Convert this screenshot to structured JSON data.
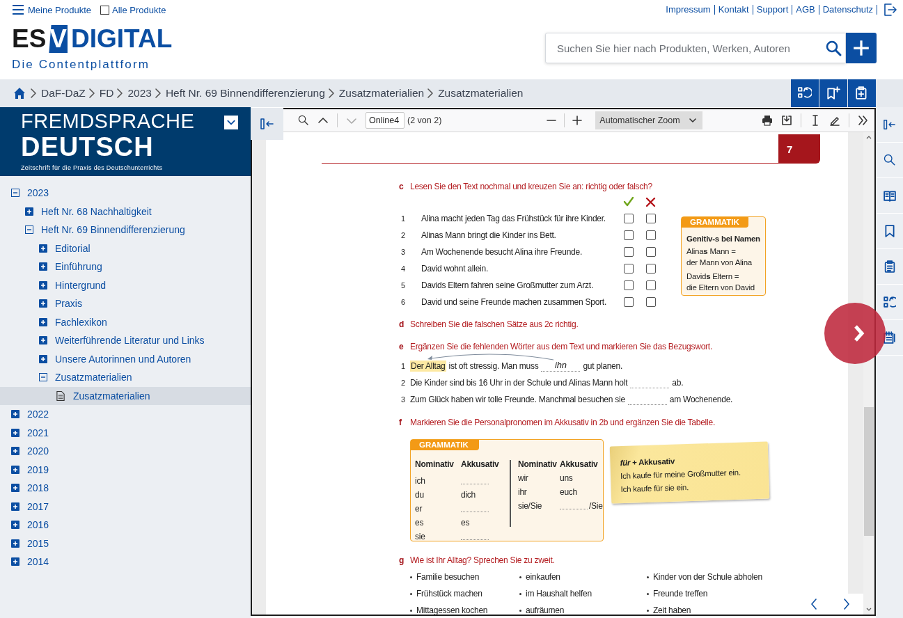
{
  "header": {
    "menu_label": "Meine Produkte",
    "all_products": {
      "label": "Alle Produkte",
      "checked": false
    },
    "links": [
      "Impressum",
      "Kontakt",
      "Support",
      "AGB",
      "Datenschutz"
    ]
  },
  "logo": {
    "prefix": "ES",
    "mark": "V",
    "name": "DIGITAL",
    "tagline": "Die Contentplattform"
  },
  "search": {
    "placeholder": "Suchen Sie hier nach Produkten, Werken, Autoren"
  },
  "breadcrumb": [
    "DaF-DaZ",
    "FD",
    "2023",
    "Heft Nr. 69 Binnendifferenzierung",
    "Zusatzmaterialien",
    "Zusatzmaterialien"
  ],
  "sidebar": {
    "banner": {
      "line1": "FREMDSPRACHE",
      "line2": "DEUTSCH",
      "subtitle": "Zeitschrift für die Praxis des Deutschunterrichts"
    },
    "tree": [
      {
        "label": "2023",
        "kind": "folder",
        "expanded": true,
        "selected": false,
        "children": [
          {
            "label": "Heft Nr. 68 Nachhaltigkeit",
            "kind": "folder",
            "expanded": false,
            "selected": false
          },
          {
            "label": "Heft Nr. 69 Binnendifferenzierung",
            "kind": "folder",
            "expanded": true,
            "selected": false,
            "children": [
              {
                "label": "Editorial",
                "kind": "folder",
                "expanded": false,
                "selected": false
              },
              {
                "label": "Einführung",
                "kind": "folder",
                "expanded": false,
                "selected": false
              },
              {
                "label": "Hintergrund",
                "kind": "folder",
                "expanded": false,
                "selected": false
              },
              {
                "label": "Praxis",
                "kind": "folder",
                "expanded": false,
                "selected": false
              },
              {
                "label": "Fachlexikon",
                "kind": "folder",
                "expanded": false,
                "selected": false
              },
              {
                "label": "Weiterführende Literatur und Links",
                "kind": "folder",
                "expanded": false,
                "selected": false
              },
              {
                "label": "Unsere Autorinnen und Autoren",
                "kind": "folder",
                "expanded": false,
                "selected": false
              },
              {
                "label": "Zusatzmaterialien",
                "kind": "folder",
                "expanded": true,
                "selected": false,
                "children": [
                  {
                    "label": "Zusatzmaterialien",
                    "kind": "document",
                    "selected": true
                  }
                ]
              }
            ]
          }
        ]
      },
      {
        "label": "2022",
        "kind": "folder",
        "expanded": false,
        "selected": false
      },
      {
        "label": "2021",
        "kind": "folder",
        "expanded": false,
        "selected": false
      },
      {
        "label": "2020",
        "kind": "folder",
        "expanded": false,
        "selected": false
      },
      {
        "label": "2019",
        "kind": "folder",
        "expanded": false,
        "selected": false
      },
      {
        "label": "2018",
        "kind": "folder",
        "expanded": false,
        "selected": false
      },
      {
        "label": "2017",
        "kind": "folder",
        "expanded": false,
        "selected": false
      },
      {
        "label": "2016",
        "kind": "folder",
        "expanded": false,
        "selected": false
      },
      {
        "label": "2015",
        "kind": "folder",
        "expanded": false,
        "selected": false
      },
      {
        "label": "2014",
        "kind": "folder",
        "expanded": false,
        "selected": false
      }
    ]
  },
  "viewer": {
    "toolbar": {
      "page_input": "Online4",
      "page_count": "(2 von 2)",
      "zoom": "Automatischer Zoom"
    },
    "page": {
      "page_number": "7",
      "sections": [
        {
          "kind": "true_false",
          "letter": "c",
          "instruction": "Lesen Sie den Text nochmal und kreuzen Sie an: richtig oder falsch?",
          "items": [
            {
              "number": "1",
              "text": "Alina macht jeden Tag das Frühstück für ihre Kinder.",
              "right_checked": false,
              "wrong_checked": false
            },
            {
              "number": "2",
              "text": "Alinas Mann bringt die Kinder ins Bett.",
              "right_checked": false,
              "wrong_checked": false
            },
            {
              "number": "3",
              "text": "Am Wochenende besucht Alina ihre Freunde.",
              "right_checked": false,
              "wrong_checked": false
            },
            {
              "number": "4",
              "text": "David wohnt allein.",
              "right_checked": false,
              "wrong_checked": false
            },
            {
              "number": "5",
              "text": "Davids Eltern fahren seine Großmutter zum Arzt.",
              "right_checked": false,
              "wrong_checked": false
            },
            {
              "number": "6",
              "text": "David und seine Freunde machen zusammen Sport.",
              "right_checked": false,
              "wrong_checked": false
            }
          ],
          "aside": {
            "title": "GRAMMATIK",
            "heading": "Genitiv-s bei Namen",
            "lines": [
              "Alina**s** Mann =",
              "der Mann von Alina",
              "David**s** Eltern =",
              "die Eltern von David"
            ]
          }
        },
        {
          "kind": "instruction",
          "letter": "d",
          "instruction": "Schreiben Sie die falschen Sätze aus 2c richtig."
        },
        {
          "kind": "fill_in",
          "letter": "e",
          "instruction": "Ergänzen Sie die fehlenden Wörter aus dem Text und markieren Sie das Bezugswort.",
          "items": [
            {
              "number": "1",
              "highlight": "Der Alltag",
              "before": "ist oft stressig. Man muss",
              "answer": "ihn",
              "after": "gut planen."
            },
            {
              "number": "2",
              "before": "Die Kinder sind bis 16 Uhr in der Schule und Alinas Mann holt",
              "after": "ab."
            },
            {
              "number": "3",
              "before": "Zum Glück haben wir tolle Freunde. Manchmal besuchen sie",
              "after": "am Wochenende."
            }
          ]
        },
        {
          "kind": "table",
          "letter": "f",
          "instruction": "Markieren Sie die Personalpronomen im Akkusativ in 2b und ergänzen Sie die Tabelle.",
          "grammar": {
            "title": "GRAMMATIK",
            "columns": [
              "Nominativ",
              "Akkusativ",
              "Nominativ",
              "Akkusativ"
            ],
            "left_rows": [
              {
                "nominative": "ich"
              },
              {
                "nominative": "du",
                "accusative": "dich"
              },
              {
                "nominative": "er"
              },
              {
                "nominative": "es",
                "accusative": "es"
              },
              {
                "nominative": "sie"
              }
            ],
            "right_rows": [
              {
                "nominative": "wir",
                "accusative": "uns"
              },
              {
                "nominative": "ihr",
                "accusative": "euch"
              },
              {
                "nominative": "sie/Sie",
                "suffix": "/Sie"
              }
            ]
          },
          "note": {
            "title": "*für* + Akkusativ",
            "lines": [
              "Ich kaufe für meine Großmutter ein.",
              "Ich kaufe für sie ein."
            ]
          }
        },
        {
          "kind": "topics",
          "letter": "g",
          "instruction": "Wie ist Ihr Alltag? Sprechen Sie zu zweit.",
          "columns": [
            [
              "Familie besuchen",
              "Frühstück machen",
              "Mittagessen kochen"
            ],
            [
              "einkaufen",
              "im Haushalt helfen",
              "aufräumen"
            ],
            [
              "Kinder von der Schule abholen",
              "Freunde treffen",
              "Zeit haben"
            ]
          ]
        }
      ]
    }
  }
}
